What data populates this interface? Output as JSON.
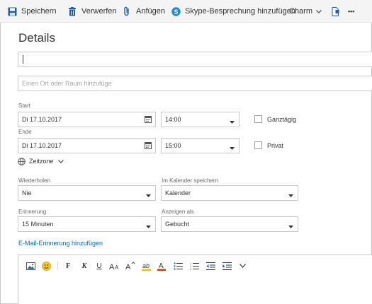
{
  "toolbar": {
    "save_label": "Speichern",
    "discard_label": "Verwerfen",
    "attach_label": "Anfügen",
    "skype_label": "Skype-Besprechung hinzufügen",
    "charm_label": "Charm",
    "more_label": "•••"
  },
  "page": {
    "title": "Details"
  },
  "fields": {
    "title_value": "",
    "location_placeholder": "Einen Ort oder Raum hinzufüge"
  },
  "start": {
    "label": "Start",
    "date": "Di 17.10.2017",
    "time": "14:00"
  },
  "end": {
    "label": "Ende",
    "date": "Di 17.10.2017",
    "time": "15:00"
  },
  "all_day_label": "Ganztägig",
  "private_label": "Privat",
  "timezone_label": "Zeitzone",
  "repeat": {
    "label": "Wiederholen",
    "value": "Nie"
  },
  "calendar": {
    "label": "Im Kalender speichern",
    "value": "Kalender"
  },
  "reminder": {
    "label": "Erinnerung",
    "value": "15 Minuten"
  },
  "show_as": {
    "label": "Anzeigen als",
    "value": "Gebucht"
  },
  "email_reminder_link": "E-Mail-Erinnerung hinzufügen",
  "editor_toolbar": {
    "bold": "F",
    "italic": "K",
    "underline": "U"
  },
  "colors": {
    "accent": "#0a66b8",
    "skype": "#1d8ad6",
    "highlight": "#f2c500",
    "font_color": "#d83b01"
  }
}
